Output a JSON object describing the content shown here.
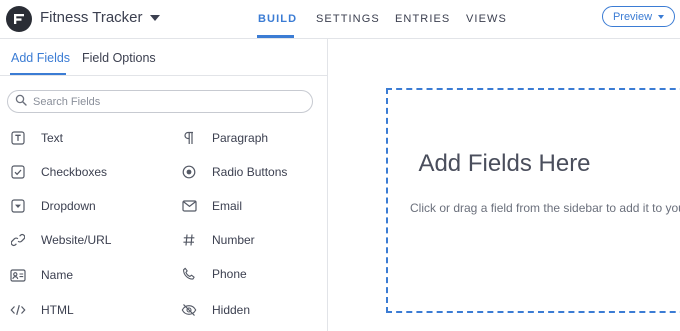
{
  "header": {
    "app_title": "Fitness Tracker",
    "nav_tabs": [
      {
        "label": "BUILD",
        "active": true
      },
      {
        "label": "SETTINGS",
        "active": false
      },
      {
        "label": "ENTRIES",
        "active": false
      },
      {
        "label": "VIEWS",
        "active": false
      }
    ],
    "preview_label": "Preview"
  },
  "sidebar": {
    "tabs": [
      {
        "label": "Add Fields",
        "active": true
      },
      {
        "label": "Field Options",
        "active": false
      }
    ],
    "search": {
      "placeholder": "Search Fields",
      "value": ""
    },
    "fields": [
      {
        "label": "Text",
        "icon": "text-field-icon"
      },
      {
        "label": "Paragraph",
        "icon": "paragraph-icon"
      },
      {
        "label": "Checkboxes",
        "icon": "checkbox-icon"
      },
      {
        "label": "Radio Buttons",
        "icon": "radio-icon"
      },
      {
        "label": "Dropdown",
        "icon": "dropdown-icon"
      },
      {
        "label": "Email",
        "icon": "envelope-icon"
      },
      {
        "label": "Website/URL",
        "icon": "link-icon"
      },
      {
        "label": "Number",
        "icon": "hash-icon"
      },
      {
        "label": "Name",
        "icon": "id-card-icon"
      },
      {
        "label": "Phone",
        "icon": "phone-icon"
      },
      {
        "label": "HTML",
        "icon": "code-icon"
      },
      {
        "label": "Hidden",
        "icon": "eye-slash-icon"
      }
    ]
  },
  "canvas": {
    "title": "Add Fields Here",
    "subtitle": "Click or drag a field from the sidebar to add it to your"
  },
  "colors": {
    "accent": "#3b7cd4",
    "text": "#3c4050",
    "border": "#e2e4e8",
    "logo_bg": "#2a2d35"
  }
}
